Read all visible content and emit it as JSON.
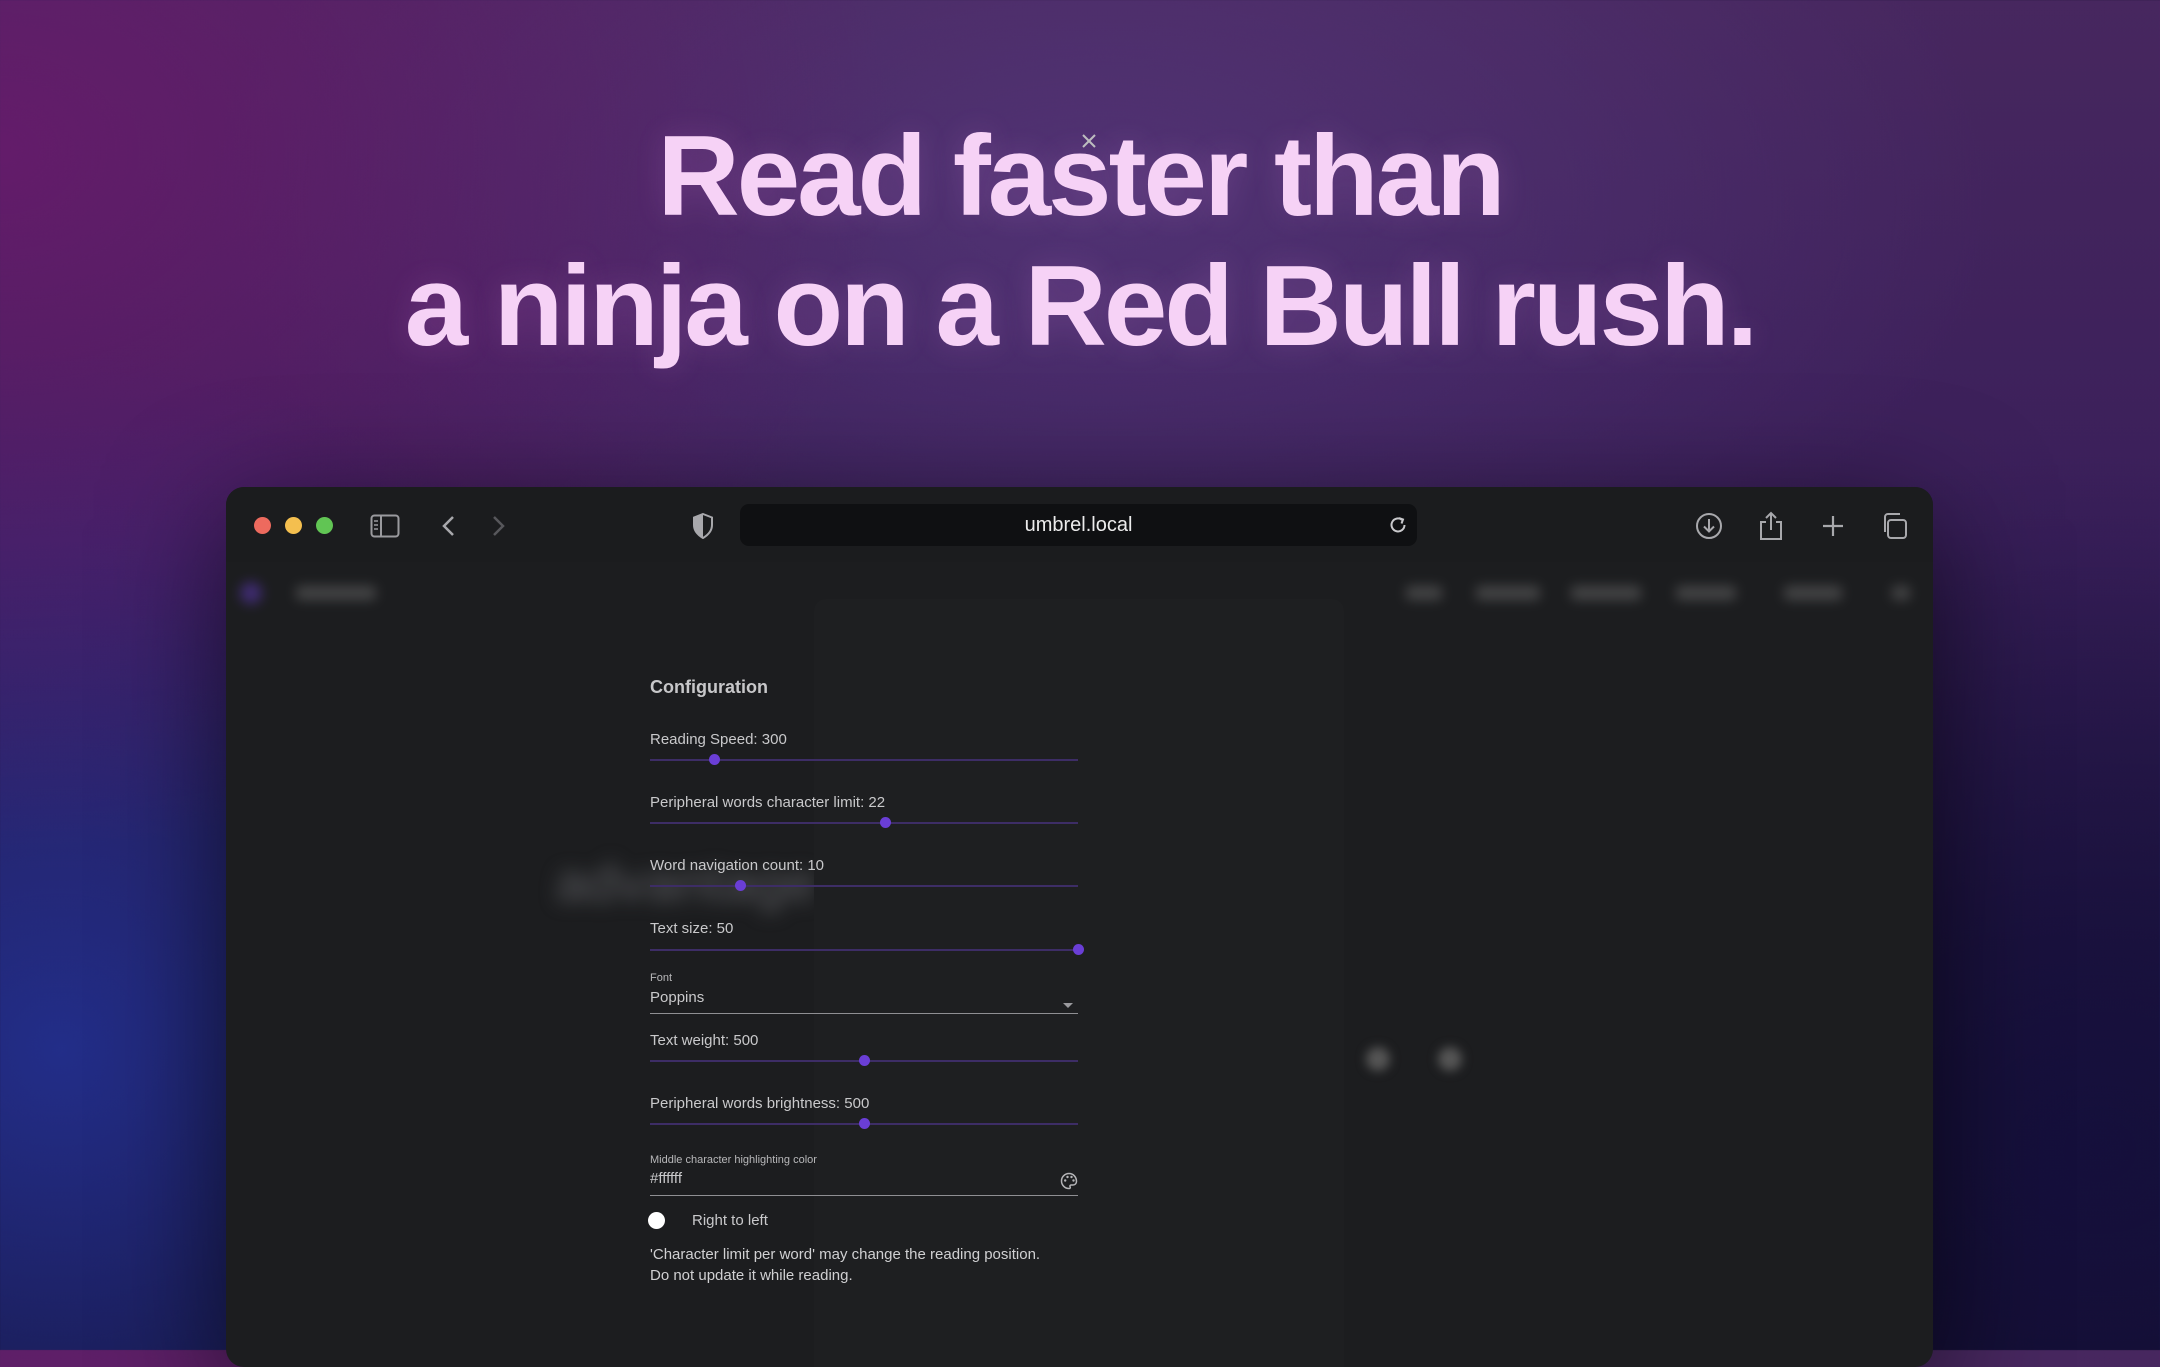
{
  "hero": {
    "line1": "Read faster than",
    "line2": "a ninja on a Red Bull rush."
  },
  "browser": {
    "url": "umbrel.local"
  },
  "background_text": "advantage                                    channels, and",
  "modal": {
    "title": "Configuration",
    "reading_speed": {
      "label": "Reading Speed: 300",
      "value_fraction": 0.15
    },
    "peripheral_limit": {
      "label": "Peripheral words character limit: 22",
      "value_fraction": 0.55
    },
    "word_nav": {
      "label": "Word navigation count: 10",
      "value_fraction": 0.21
    },
    "text_size": {
      "label": "Text size: 50",
      "value_fraction": 1.0
    },
    "font": {
      "label": "Font",
      "value": "Poppins"
    },
    "text_weight": {
      "label": "Text weight: 500",
      "value_fraction": 0.5
    },
    "peripheral_brightness": {
      "label": "Peripheral words brightness: 500",
      "value_fraction": 0.5
    },
    "highlight_color": {
      "label": "Middle character highlighting color",
      "value": "#ffffff"
    },
    "rtl": {
      "label": "Right to left",
      "checked": false
    },
    "note_line1": "'Character limit per word' may change the reading position.",
    "note_line2": "Do not update it while reading."
  },
  "colors": {
    "accent": "#6a3ed6",
    "hero_text": "#f6d2f6",
    "window_bg": "#1c1d1f"
  }
}
